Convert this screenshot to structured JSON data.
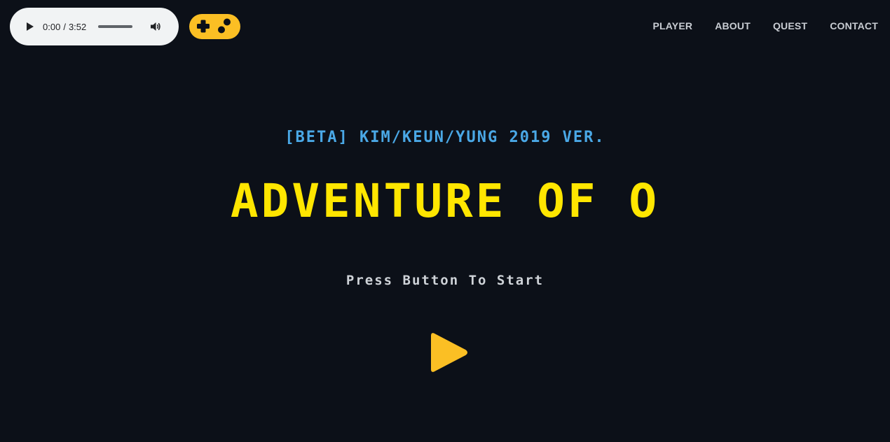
{
  "audio": {
    "current_time": "0:00",
    "separator": "/",
    "duration": "3:52",
    "play_icon": "play-icon",
    "volume_icon": "volume-icon"
  },
  "logo": {
    "icon": "gamepad-icon",
    "color": "#fbbf24"
  },
  "nav": {
    "items": [
      {
        "label": "PLAYER"
      },
      {
        "label": "ABOUT"
      },
      {
        "label": "QUEST"
      },
      {
        "label": "CONTACT"
      }
    ]
  },
  "hero": {
    "subtitle": "[BETA] KIM/KEUN/YUNG 2019 VER.",
    "title": "ADVENTURE OF O",
    "prompt": "Press Button To Start",
    "start_icon": "play-triangle-icon"
  },
  "colors": {
    "background": "#0c1018",
    "subtitle": "#4aa8e6",
    "title": "#ffe600",
    "accent": "#fbbf24"
  }
}
